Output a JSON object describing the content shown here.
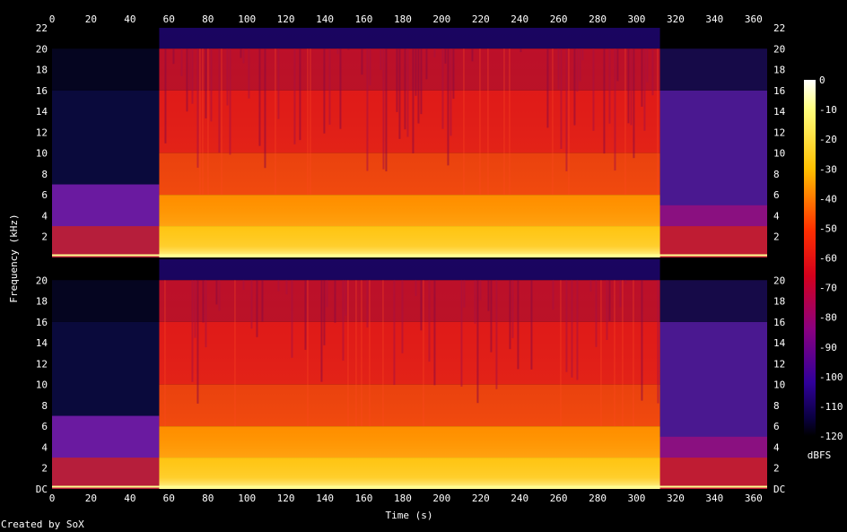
{
  "chart_data": {
    "type": "heatmap",
    "title": "",
    "xlabel": "Time (s)",
    "ylabel": "Frequency (kHz)",
    "x_ticks": [
      "0",
      "20",
      "40",
      "60",
      "80",
      "100",
      "120",
      "140",
      "160",
      "180",
      "200",
      "220",
      "240",
      "260",
      "280",
      "300",
      "320",
      "340",
      "360"
    ],
    "y_ticks_top": [
      "2",
      "4",
      "6",
      "8",
      "10",
      "12",
      "14",
      "16",
      "18",
      "20",
      "22"
    ],
    "y_ticks_bottom": [
      "DC",
      "2",
      "4",
      "6",
      "8",
      "10",
      "12",
      "14",
      "16",
      "18",
      "20"
    ],
    "xlim": [
      0,
      367
    ],
    "ylim_khz": [
      0,
      22
    ],
    "channels": 2,
    "colorbar": {
      "label": "dBFS",
      "ticks": [
        "0",
        "-10",
        "-20",
        "-30",
        "-40",
        "-50",
        "-60",
        "-70",
        "-80",
        "-90",
        "-100",
        "-110",
        "-120"
      ],
      "range": [
        -120,
        0
      ]
    },
    "segments": [
      {
        "start_s": 0,
        "end_s": 55,
        "level": "quiet intro, content mostly below 7 kHz, band-limited to 16 kHz"
      },
      {
        "start_s": 55,
        "end_s": 312,
        "level": "full band energy up to 20 kHz"
      },
      {
        "start_s": 312,
        "end_s": 367,
        "level": "fade out, band-limited to 16 kHz"
      }
    ]
  },
  "footer": {
    "credit": "Created by SoX"
  }
}
